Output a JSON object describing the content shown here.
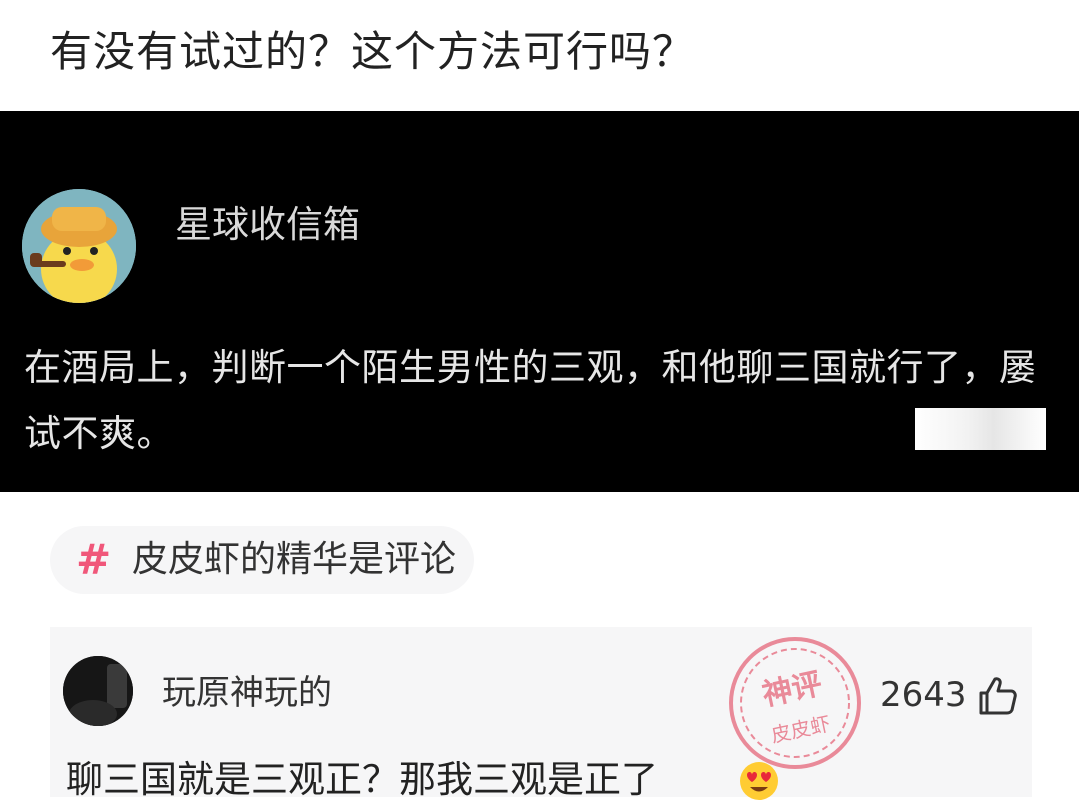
{
  "post": {
    "title": "有没有试过的？这个方法可行吗？"
  },
  "quoted_card": {
    "account_name": "星球收信箱",
    "text": "在酒局上，判断一个陌生男性的三观，和他聊三国就行了，屡试不爽。"
  },
  "topic": {
    "icon": "hash-icon",
    "label": "皮皮虾的精华是评论",
    "accent_color": "#f0577a"
  },
  "comment": {
    "username": "玩原神玩的",
    "likes": "2643",
    "like_icon": "thumbs-up-icon",
    "text": "聊三国就是三观正？那我三观是正了",
    "emoji": "heart-eyes-emoji"
  },
  "watermark": {
    "line1": "神评",
    "line2": "皮皮虾",
    "color": "#e0334d"
  }
}
